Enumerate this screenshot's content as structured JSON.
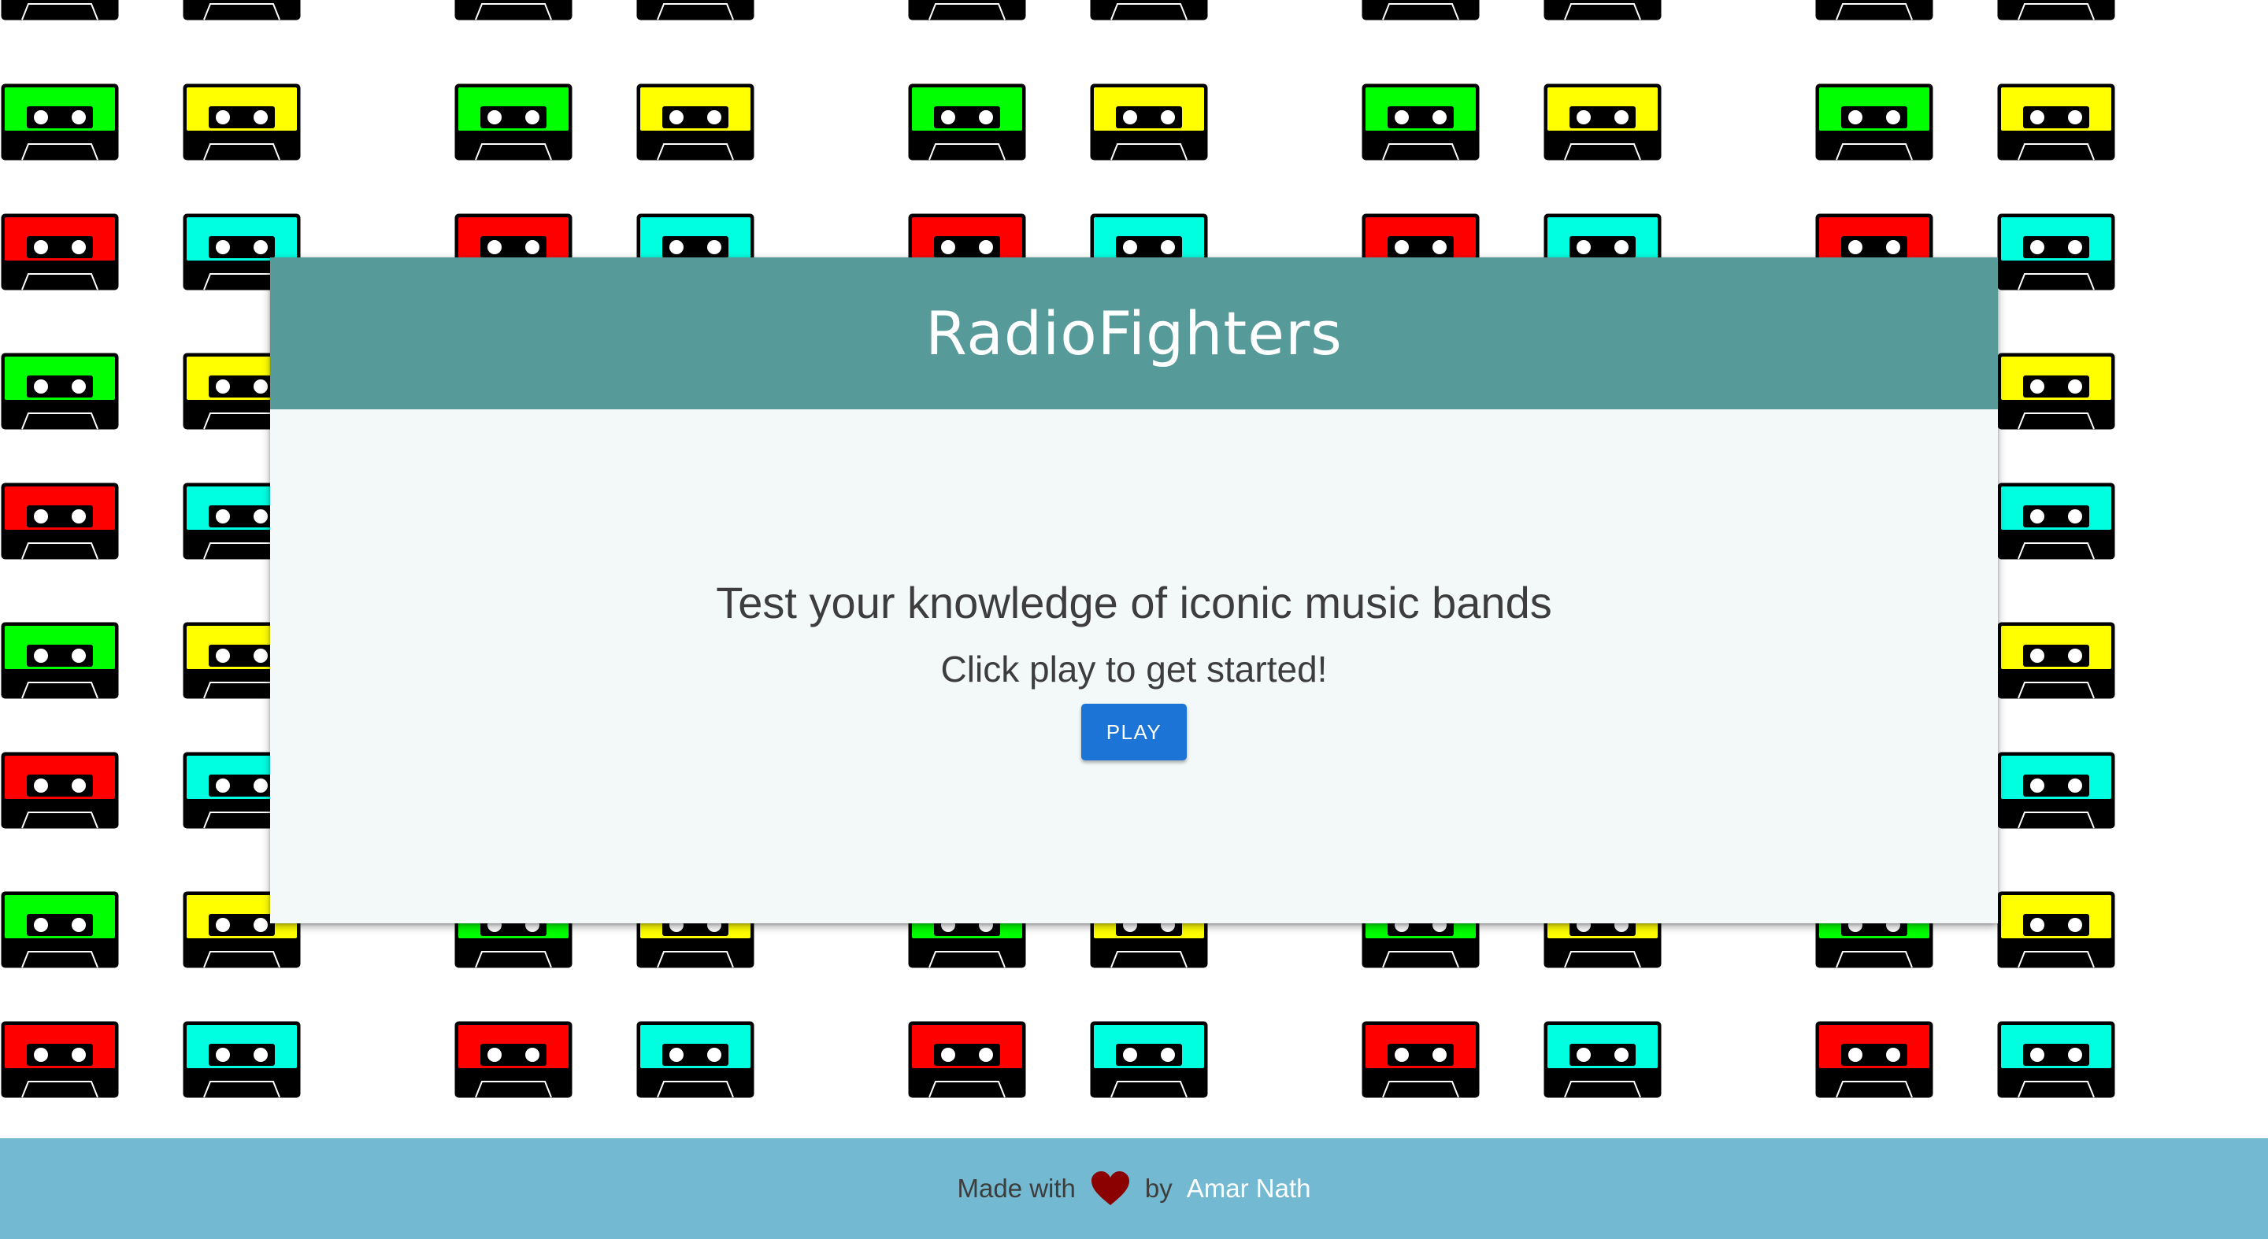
{
  "app": {
    "title": "RadioFighters"
  },
  "intro": {
    "tagline": "Test your knowledge of iconic music bands",
    "subtitle": "Click play to get started!",
    "play_label": "PLAY"
  },
  "footer": {
    "made_with": "Made with",
    "by": "by",
    "author": "Amar Nath",
    "heart_icon": "heart-icon"
  },
  "colors": {
    "header": "#569a99",
    "card": "#f3f8f8",
    "button": "#1b74d6",
    "footer": "#73b9d1",
    "heart": "#8b0000",
    "cassette_green": "#00ff00",
    "cassette_yellow": "#ffff00",
    "cassette_red": "#ff0000",
    "cassette_cyan": "#00ffe0"
  },
  "background_icon": "cassette-tape-icon"
}
